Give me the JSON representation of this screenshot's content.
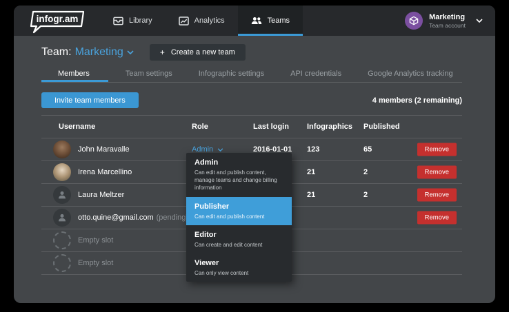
{
  "brand": {
    "logo_text": "infogr.am"
  },
  "nav": {
    "items": [
      {
        "label": "Library",
        "icon": "library-icon"
      },
      {
        "label": "Analytics",
        "icon": "analytics-icon"
      },
      {
        "label": "Teams",
        "icon": "teams-icon",
        "active": true
      }
    ]
  },
  "account": {
    "name": "Marketing",
    "subtitle": "Team account"
  },
  "team_header": {
    "prefix": "Team:",
    "team_name": "Marketing",
    "create_button_label": "Create a new team",
    "plus": "+"
  },
  "section_tabs": {
    "items": [
      "Members",
      "Team settings",
      "Infographic settings",
      "API credentials",
      "Google Analytics tracking"
    ],
    "active": "Members"
  },
  "toolbar": {
    "invite_button_label": "Invite team members",
    "members_summary": "4 members (2 remaining)"
  },
  "table": {
    "columns": [
      "Username",
      "Role",
      "Last login",
      "Infographics",
      "Published"
    ],
    "rows": [
      {
        "username": "John Maravalle",
        "role": "Admin",
        "last_login": "2016-01-01",
        "infographics": "123",
        "published": "65",
        "remove_label": "Remove",
        "avatar": "photo"
      },
      {
        "username": "Irena Marcellino",
        "infographics": "21",
        "published": "2",
        "remove_label": "Remove",
        "avatar": "photo"
      },
      {
        "username": "Laura Meltzer",
        "infographics": "21",
        "published": "2",
        "remove_label": "Remove",
        "avatar": "placeholder"
      },
      {
        "username": "otto.quine@gmail.com",
        "pending_label": "(pending)",
        "remove_label": "Remove",
        "avatar": "placeholder"
      },
      {
        "username": "Empty slot",
        "avatar": "empty"
      },
      {
        "username": "Empty slot",
        "avatar": "empty"
      }
    ]
  },
  "role_dropdown": {
    "items": [
      {
        "title": "Admin",
        "description": "Can edit and publish content, manage teams and change billing information"
      },
      {
        "title": "Publisher",
        "description": "Can edit and publish content",
        "selected": true
      },
      {
        "title": "Editor",
        "description": "Can create and edit content"
      },
      {
        "title": "Viewer",
        "description": "Can only view content"
      }
    ]
  },
  "colors": {
    "accent_blue": "#3b9ad6",
    "danger_red": "#c5302e",
    "account_purple": "#7b4fa0"
  }
}
